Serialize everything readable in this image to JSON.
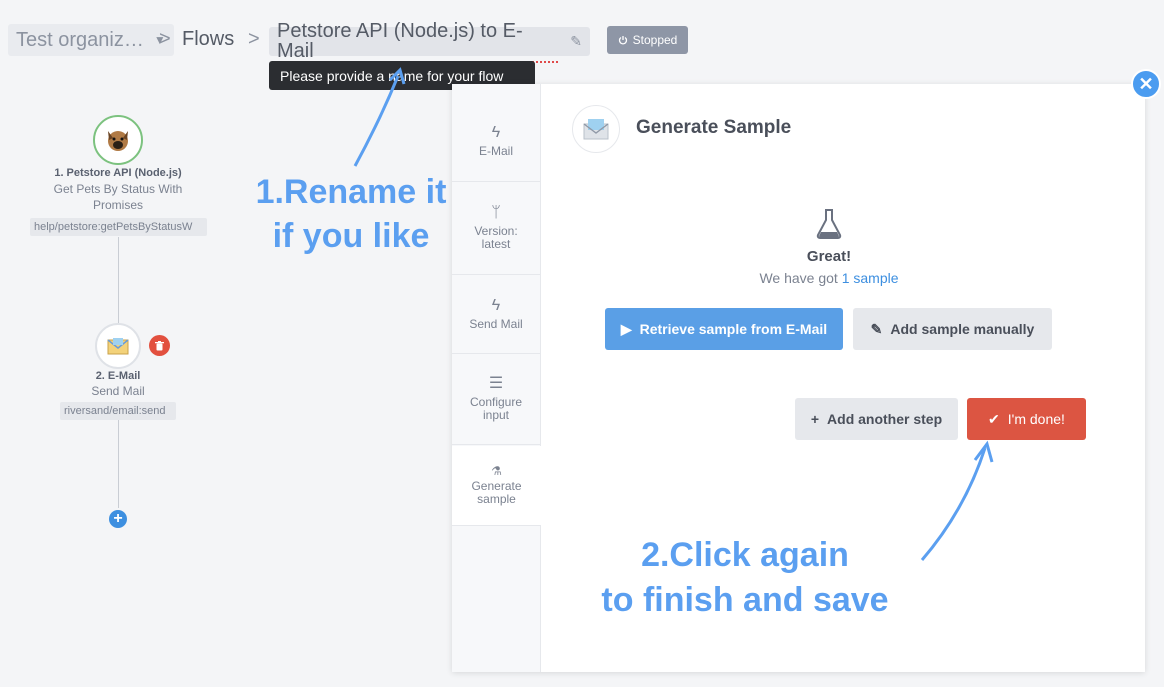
{
  "header": {
    "org_name": "Test organiz…",
    "breadcrumb_sep": ">",
    "flows_label": "Flows",
    "flow_name": "Petstore API (Node.js) to E-Mail",
    "status": "Stopped",
    "tooltip": "Please provide a name for your flow"
  },
  "steps": [
    {
      "title": "1. Petstore API (Node.js)",
      "subtitle": "Get Pets By Status With Promises",
      "tag": "help/petstore:getPetsByStatusW"
    },
    {
      "title": "2. E-Mail",
      "subtitle": "Send Mail",
      "tag": "riversand/email:send"
    }
  ],
  "annotations": {
    "rename": [
      "1.Rename it",
      "if you like"
    ],
    "click_again": [
      "2.Click again",
      "to finish and save"
    ]
  },
  "panel": {
    "tabs": [
      {
        "label": "E-Mail",
        "icon": "bolt-icon"
      },
      {
        "label": "Version: latest",
        "icon": "branch-icon"
      },
      {
        "label": "Send Mail",
        "icon": "bolt-icon"
      },
      {
        "label": "Configure input",
        "icon": "menu-icon"
      },
      {
        "label": "Generate sample",
        "icon": "flask-icon"
      }
    ],
    "title": "Generate Sample",
    "great": "Great!",
    "got_prefix": "We have got",
    "got_link": "1 sample",
    "retrieve_label": "Retrieve sample from E-Mail",
    "add_manual_label": "Add sample manually",
    "add_step_label": "Add another step",
    "done_label": "I'm done!"
  },
  "colors": {
    "accent_blue": "#5a9fe6",
    "done_red": "#dc5542",
    "annotation_blue": "#5b9ff0",
    "step_border_green": "#7cc27f"
  }
}
